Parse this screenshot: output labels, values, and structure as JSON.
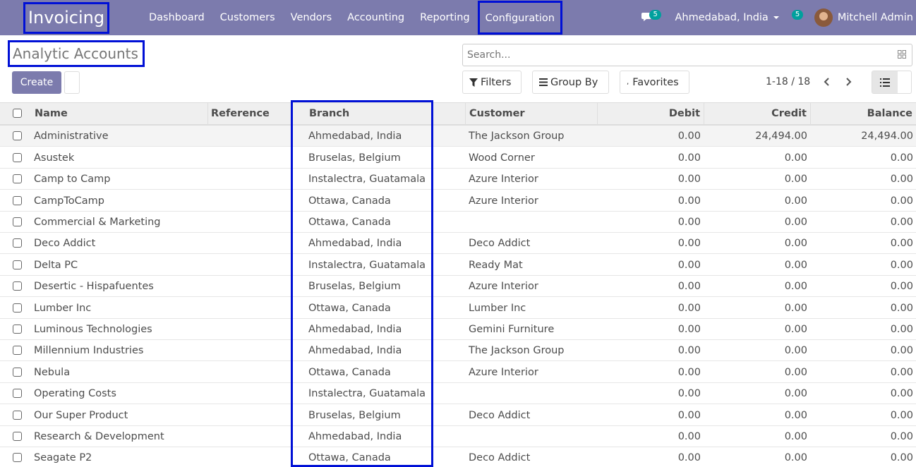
{
  "navbar": {
    "app_name": "Invoicing",
    "menu": [
      "Dashboard",
      "Customers",
      "Vendors",
      "Accounting",
      "Reporting",
      "Configuration"
    ],
    "messages_count": "5",
    "company": "Ahmedabad, India",
    "activity_count": "5",
    "user": "Mitchell Admin"
  },
  "control_panel": {
    "title": "Analytic Accounts",
    "create_label": "Create",
    "search_placeholder": "Search...",
    "filters_label": "Filters",
    "group_by_label": "Group By",
    "favorites_label": "Favorites",
    "pager": "1-18 / 18"
  },
  "table": {
    "columns": [
      "Name",
      "Reference",
      "Branch",
      "Customer",
      "Debit",
      "Credit",
      "Balance"
    ],
    "rows": [
      {
        "name": "Administrative",
        "reference": "",
        "branch": "Ahmedabad, India",
        "customer": "The Jackson Group",
        "debit": "0.00",
        "credit": "24,494.00",
        "balance": "24,494.00"
      },
      {
        "name": "Asustek",
        "reference": "",
        "branch": "Bruselas, Belgium",
        "customer": "Wood Corner",
        "debit": "0.00",
        "credit": "0.00",
        "balance": "0.00"
      },
      {
        "name": "Camp to Camp",
        "reference": "",
        "branch": "Instalectra, Guatamala",
        "customer": "Azure Interior",
        "debit": "0.00",
        "credit": "0.00",
        "balance": "0.00"
      },
      {
        "name": "CampToCamp",
        "reference": "",
        "branch": "Ottawa, Canada",
        "customer": "Azure Interior",
        "debit": "0.00",
        "credit": "0.00",
        "balance": "0.00"
      },
      {
        "name": "Commercial & Marketing",
        "reference": "",
        "branch": "Ottawa, Canada",
        "customer": "",
        "debit": "0.00",
        "credit": "0.00",
        "balance": "0.00"
      },
      {
        "name": "Deco Addict",
        "reference": "",
        "branch": "Ahmedabad, India",
        "customer": "Deco Addict",
        "debit": "0.00",
        "credit": "0.00",
        "balance": "0.00"
      },
      {
        "name": "Delta PC",
        "reference": "",
        "branch": "Instalectra, Guatamala",
        "customer": "Ready Mat",
        "debit": "0.00",
        "credit": "0.00",
        "balance": "0.00"
      },
      {
        "name": "Desertic - Hispafuentes",
        "reference": "",
        "branch": "Bruselas, Belgium",
        "customer": "Azure Interior",
        "debit": "0.00",
        "credit": "0.00",
        "balance": "0.00"
      },
      {
        "name": "Lumber Inc",
        "reference": "",
        "branch": "Ottawa, Canada",
        "customer": "Lumber Inc",
        "debit": "0.00",
        "credit": "0.00",
        "balance": "0.00"
      },
      {
        "name": "Luminous Technologies",
        "reference": "",
        "branch": "Ahmedabad, India",
        "customer": "Gemini Furniture",
        "debit": "0.00",
        "credit": "0.00",
        "balance": "0.00"
      },
      {
        "name": "Millennium Industries",
        "reference": "",
        "branch": "Ahmedabad, India",
        "customer": "The Jackson Group",
        "debit": "0.00",
        "credit": "0.00",
        "balance": "0.00"
      },
      {
        "name": "Nebula",
        "reference": "",
        "branch": "Ottawa, Canada",
        "customer": "Azure Interior",
        "debit": "0.00",
        "credit": "0.00",
        "balance": "0.00"
      },
      {
        "name": "Operating Costs",
        "reference": "",
        "branch": "Instalectra, Guatamala",
        "customer": "",
        "debit": "0.00",
        "credit": "0.00",
        "balance": "0.00"
      },
      {
        "name": "Our Super Product",
        "reference": "",
        "branch": "Bruselas, Belgium",
        "customer": "Deco Addict",
        "debit": "0.00",
        "credit": "0.00",
        "balance": "0.00"
      },
      {
        "name": "Research & Development",
        "reference": "",
        "branch": "Ahmedabad, India",
        "customer": "",
        "debit": "0.00",
        "credit": "0.00",
        "balance": "0.00"
      },
      {
        "name": "Seagate P2",
        "reference": "",
        "branch": "Ottawa, Canada",
        "customer": "Deco Addict",
        "debit": "0.00",
        "credit": "0.00",
        "balance": "0.00"
      }
    ]
  },
  "colors": {
    "navbar": "#7c7bad",
    "highlight": "#0010d6",
    "badge": "#00a09d"
  }
}
